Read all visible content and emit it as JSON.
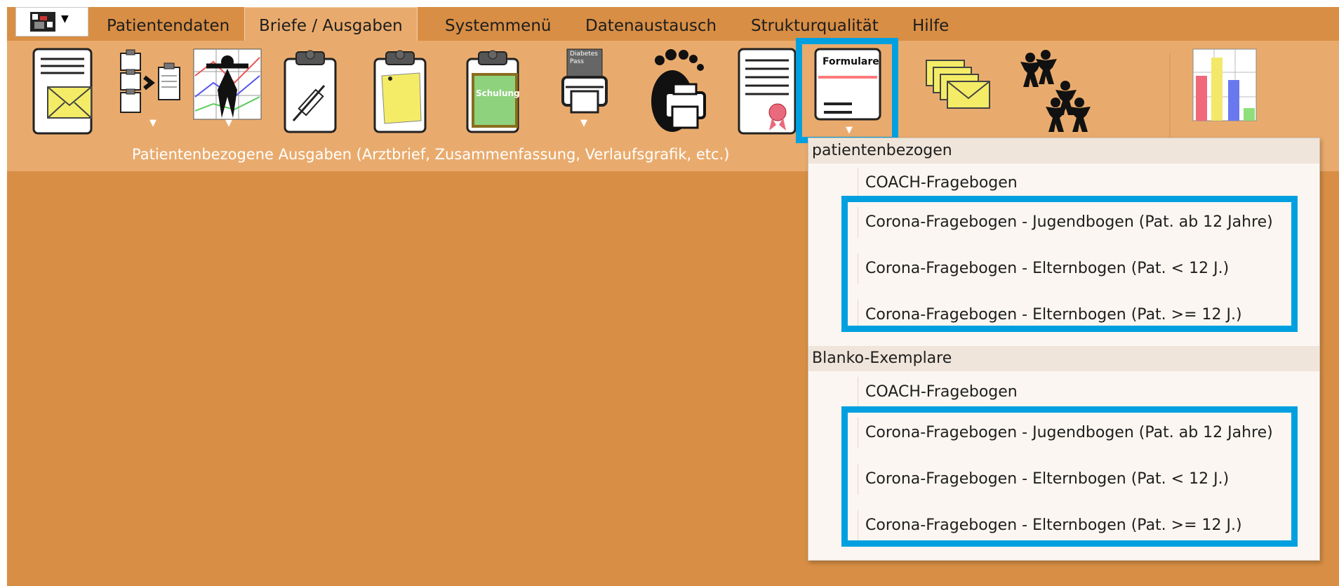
{
  "menubar": {
    "tabs": [
      {
        "label": "Patientendaten"
      },
      {
        "label": "Briefe / Ausgaben"
      },
      {
        "label": "Systemmenü"
      },
      {
        "label": "Datenaustausch"
      },
      {
        "label": "Strukturqualität"
      },
      {
        "label": "Hilfe"
      }
    ],
    "active_tab": "Briefe / Ausgaben"
  },
  "ribbon": {
    "group_label": "Patientenbezogene Ausgaben (Arztbrief, Zusammenfassung, Verlaufsgrafik, etc.)",
    "icons": {
      "diabetes_pass": "Diabetes Pass",
      "schulung": "Schulung",
      "formulare": "Formulare"
    }
  },
  "dropdown": {
    "sections": [
      {
        "header": "patientenbezogen",
        "items": [
          "COACH-Fragebogen",
          "Corona-Fragebogen - Jugendbogen (Pat. ab 12 Jahre)",
          "Corona-Fragebogen - Elternbogen (Pat. < 12 J.)",
          "Corona-Fragebogen - Elternbogen (Pat. >= 12 J.)"
        ]
      },
      {
        "header": "Blanko-Exemplare",
        "items": [
          "COACH-Fragebogen",
          "Corona-Fragebogen - Jugendbogen (Pat. ab 12 Jahre)",
          "Corona-Fragebogen - Elternbogen (Pat. < 12 J.)",
          "Corona-Fragebogen - Elternbogen (Pat. >= 12 J.)"
        ]
      }
    ]
  },
  "colors": {
    "background": "#d88e44",
    "ribbon": "#e9ab6d",
    "highlight": "#00a0e0"
  }
}
